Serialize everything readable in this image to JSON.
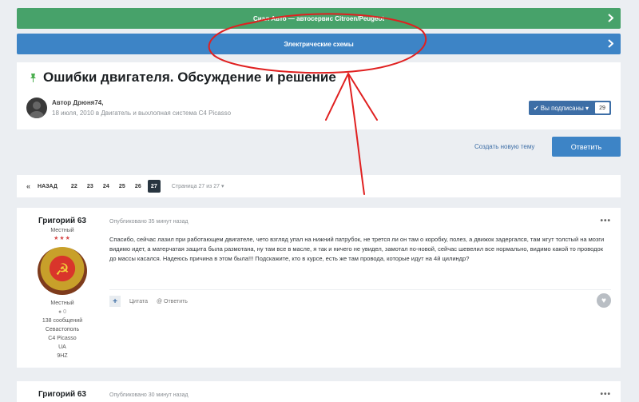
{
  "banners": {
    "green_label": "Сиал Авто — автосервис Citroen/Peugeot",
    "blue_label": "Электрические схемы"
  },
  "topic": {
    "title": "Ошибки двигателя. Обсуждение и решение",
    "author_line": "Автор Дрюня74,",
    "date_line": "18 июля, 2010 в Двигатель и выхлопная система C4 Picasso",
    "follow_label": "✔ Вы подписаны ▾",
    "follow_count": "29"
  },
  "actions": {
    "new_topic": "Создать новую тему",
    "reply": "Ответить"
  },
  "pager": {
    "prev_symbol": "«",
    "back_label": "НАЗАД",
    "pages": [
      "22",
      "23",
      "24",
      "25",
      "26",
      "27"
    ],
    "active_page": "27",
    "status": "Страница 27 из 27 ▾"
  },
  "posts": [
    {
      "author": "Григорий 63",
      "rank": "Местный",
      "stars": "★★★",
      "group": "Местный",
      "rep": "● 0",
      "messages": "138 сообщений",
      "city": "Севастополь",
      "car": "C4 Picasso",
      "country": "UA",
      "engine": "9HZ",
      "date": "Опубликовано 35 минут назад",
      "text": "Спасибо, сейчас лазил при работающем двигателе, чето  взгляд упал на нижний патрубок, не трется ли он там о коробку, полез, а движок задергался, там жгут толстый на мозги видимо идет, а матерчатая защита была размотана, ну там все в масле, я так и ничего не увидел, замотал по-новой, сейчас шевелил все нормально, видимо какой то проводок до массы касался. Надеюсь причина в этом была!!! Подскажите, кто в курсе, есть же там провода, которые идут на 4й цилиндр?",
      "quote_label": "Цитата",
      "reply_label": "@ Ответить",
      "menu": "•••"
    },
    {
      "author": "Григорий 63",
      "date": "Опубликовано 30 минут назад",
      "menu": "•••"
    }
  ],
  "icons": {
    "chevron": "chevron-right-icon",
    "pin": "pin-icon",
    "heart": "heart-icon"
  },
  "colors": {
    "green_banner": "#47a26a",
    "blue_banner": "#3d84c6",
    "accent": "#3d6ea6",
    "annotation": "#e02020"
  }
}
